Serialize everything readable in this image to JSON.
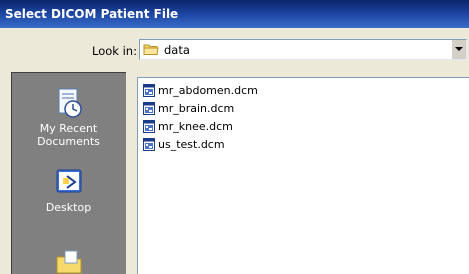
{
  "window": {
    "title": "Select DICOM Patient File"
  },
  "lookin": {
    "label": "Look in:",
    "value": "data"
  },
  "places": [
    {
      "label": "My Recent\nDocuments",
      "line1": "My Recent",
      "line2": "Documents",
      "icon": "recent-documents-icon"
    },
    {
      "label": "Desktop",
      "icon": "desktop-icon"
    },
    {
      "label": "",
      "icon": "my-documents-icon"
    }
  ],
  "files": [
    {
      "name": "mr_abdomen.dcm",
      "icon": "dicom-file-icon"
    },
    {
      "name": "mr_brain.dcm",
      "icon": "dicom-file-icon"
    },
    {
      "name": "mr_knee.dcm",
      "icon": "dicom-file-icon"
    },
    {
      "name": "us_test.dcm",
      "icon": "dicom-file-icon"
    }
  ],
  "colors": {
    "titlebar": "#0a246a",
    "places_bar": "#808080",
    "dialog_bg": "#ece9d8"
  }
}
